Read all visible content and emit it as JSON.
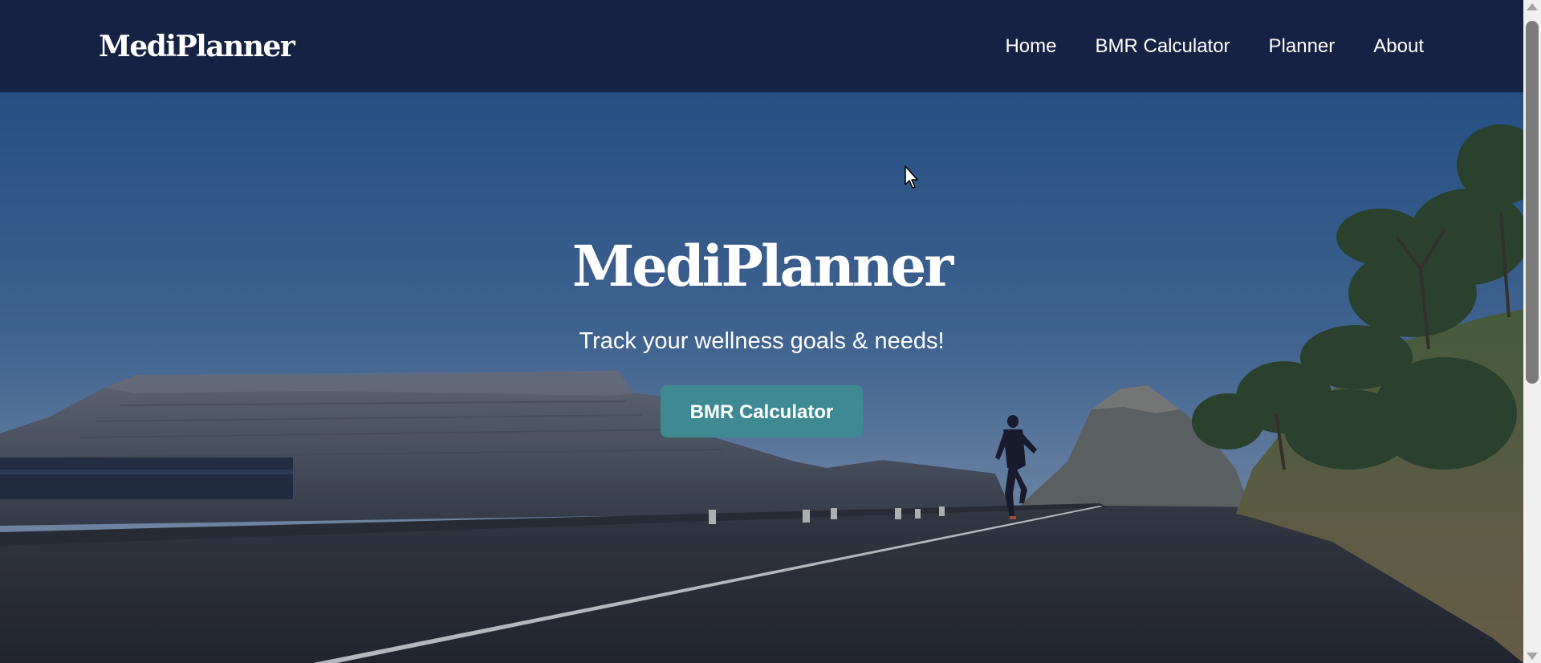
{
  "brand": {
    "name": "MediPlanner"
  },
  "nav": {
    "items": [
      {
        "label": "Home"
      },
      {
        "label": "BMR Calculator"
      },
      {
        "label": "Planner"
      },
      {
        "label": "About"
      }
    ]
  },
  "hero": {
    "title": "MediPlanner",
    "subtitle": "Track your wellness goals & needs!",
    "cta_label": "BMR Calculator",
    "background_image": "runner on mountain road"
  },
  "colors": {
    "navbar": "#162243",
    "button": "#3e8a93",
    "text": "#ffffff"
  },
  "icons": {
    "cursor": "mouse-pointer-icon"
  }
}
